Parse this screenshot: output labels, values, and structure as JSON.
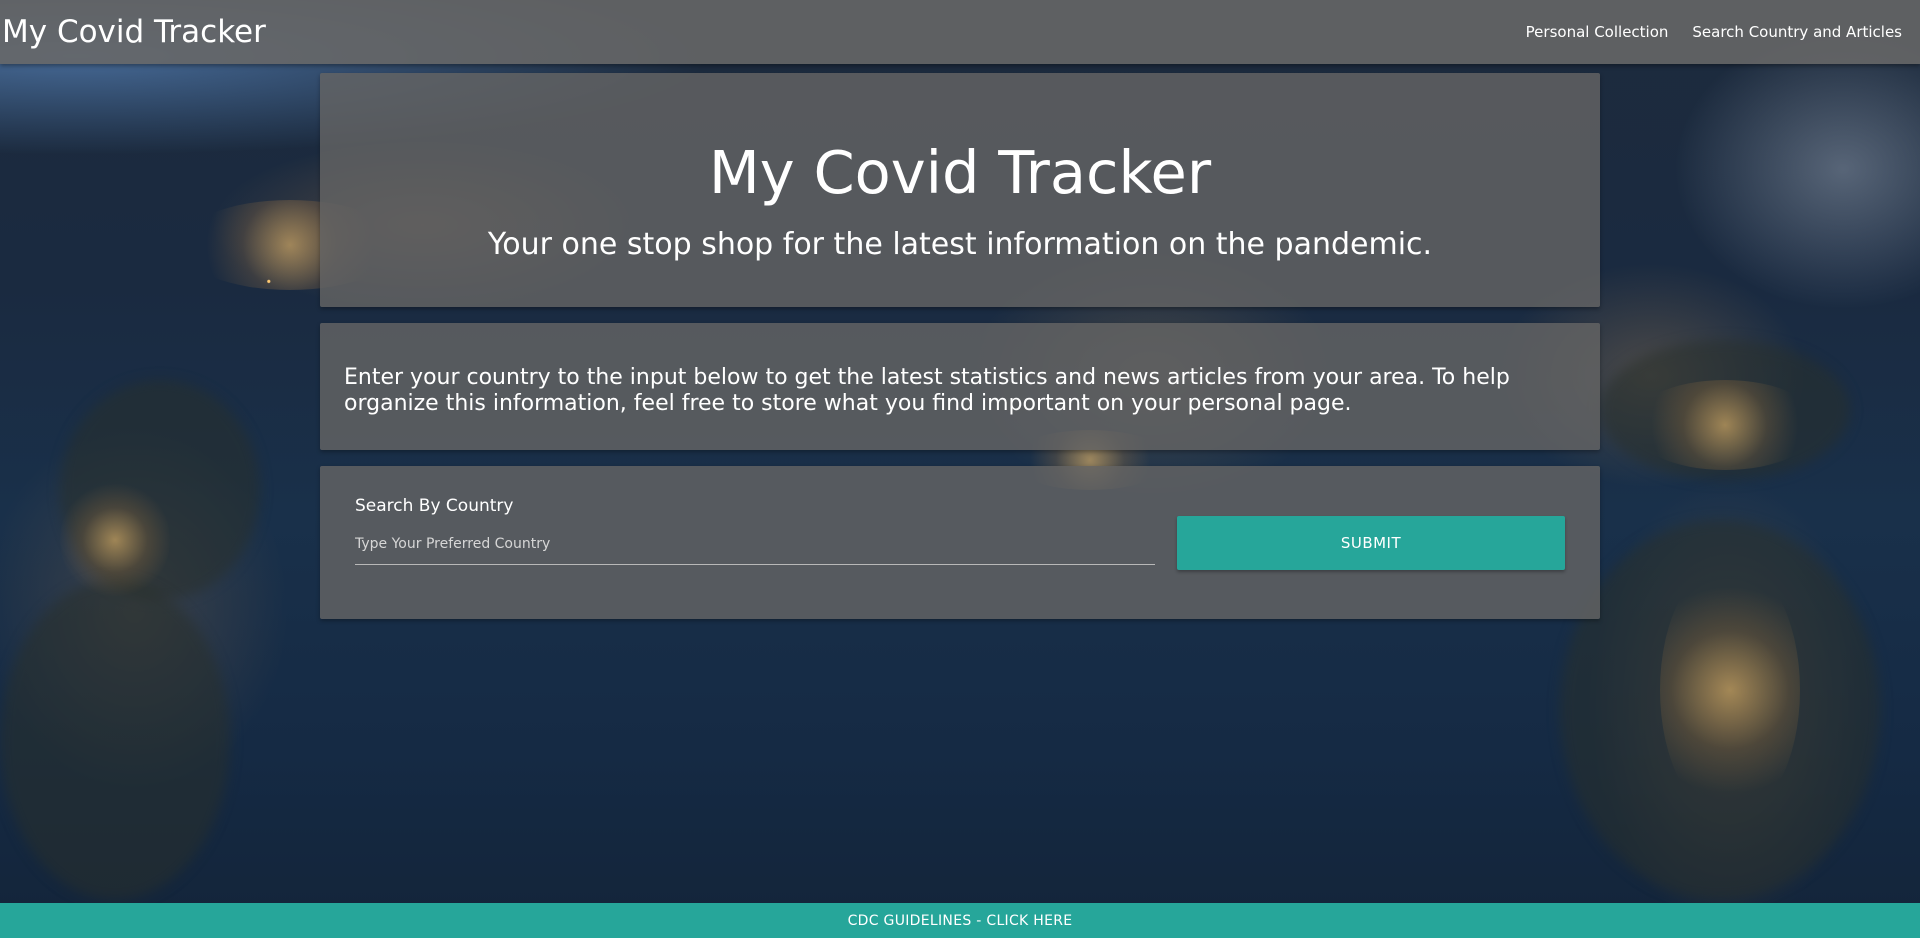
{
  "navbar": {
    "brand": "My Covid Tracker",
    "links": [
      "Personal Collection",
      "Search Country and Articles"
    ]
  },
  "hero": {
    "title": "My Covid Tracker",
    "subtitle": "Your one stop shop for the latest information on the pandemic."
  },
  "intro": {
    "text": "Enter your country to the input below to get the latest statistics and news articles from your area. To help organize this information, feel free to store what you find important on your personal page."
  },
  "search": {
    "label": "Search By Country",
    "placeholder": "Type Your Preferred Country",
    "value": "",
    "submit_label": "SUBMIT"
  },
  "footer": {
    "cdc_label": "CDC GUIDELINES - CLICK HERE"
  },
  "colors": {
    "accent": "#26a69a",
    "card_bg": "#646464",
    "navbar_bg": "#686868"
  }
}
